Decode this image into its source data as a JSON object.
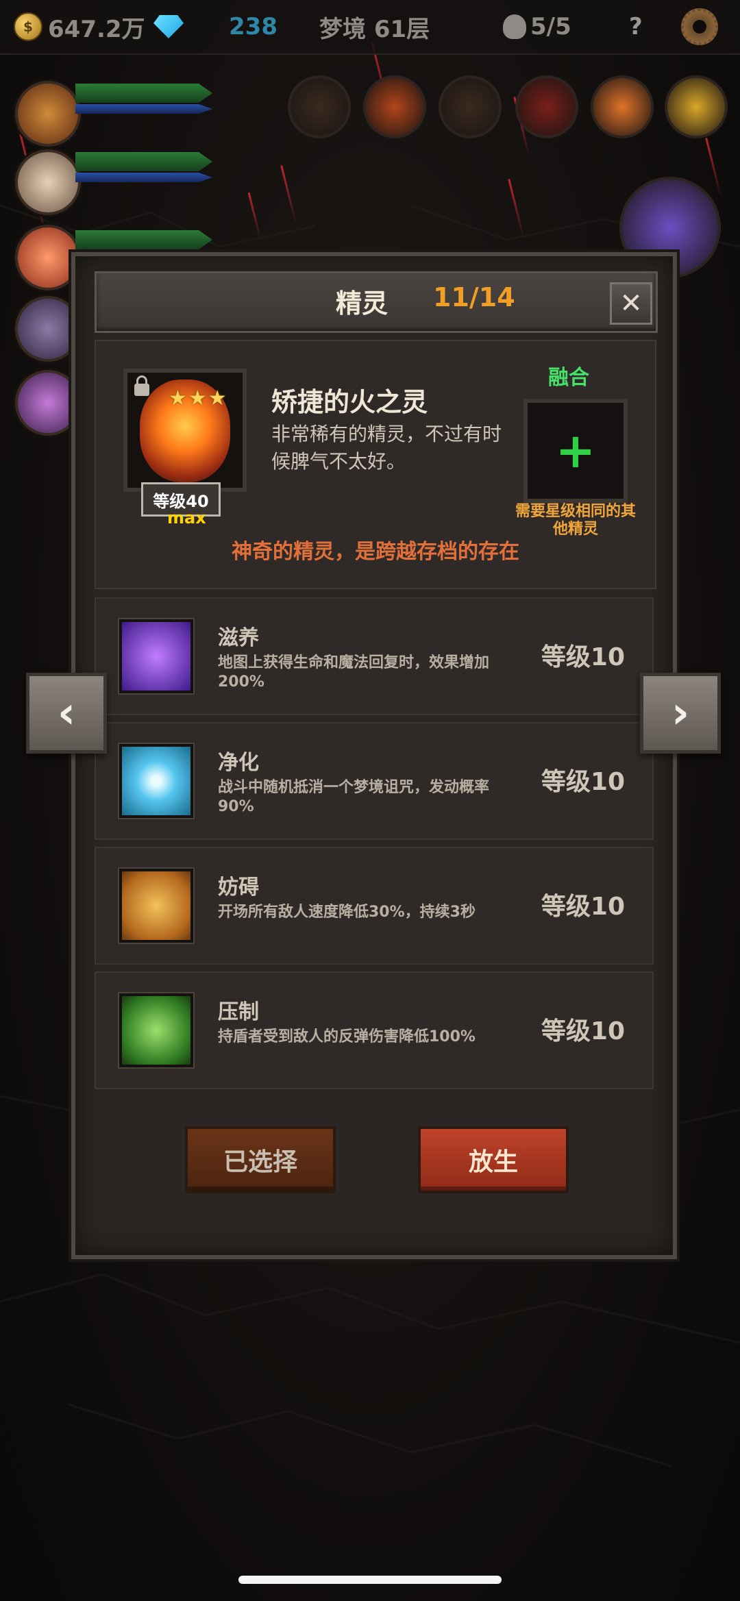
{
  "hud": {
    "gold": "647.2万",
    "gems": "238",
    "dream_floor": "梦境 61层",
    "lives": "5/5",
    "help": "?"
  },
  "modal": {
    "title": "精灵",
    "count": "11/14",
    "close": "✕",
    "spirit": {
      "name": "矫捷的火之灵",
      "stars": "★★★",
      "level": "等级40",
      "max": "max",
      "description": "非常稀有的精灵，不过有时候脾气不太好。",
      "tagline": "神奇的精灵，是跨越存档的存在"
    },
    "fuse": {
      "label": "融合",
      "plus": "+",
      "note": "需要星级相同的其他精灵"
    },
    "skills": [
      {
        "name": "滋养",
        "desc": "地图上获得生命和魔法回复时，效果增加200%",
        "level": "等级10",
        "icon_color": "#7a3fd1"
      },
      {
        "name": "净化",
        "desc": "战斗中随机抵消一个梦境诅咒，发动概率90%",
        "level": "等级10",
        "icon_color": "#3fb4e6"
      },
      {
        "name": "妨碍",
        "desc": "开场所有敌人速度降低30%，持续3秒",
        "level": "等级10",
        "icon_color": "#d9912b"
      },
      {
        "name": "压制",
        "desc": "持盾者受到敌人的反弹伤害降低100%",
        "level": "等级10",
        "icon_color": "#4fa636"
      }
    ],
    "buttons": {
      "selected": "已选择",
      "release": "放生"
    }
  },
  "nav": {
    "prev": "‹",
    "next": "›"
  }
}
